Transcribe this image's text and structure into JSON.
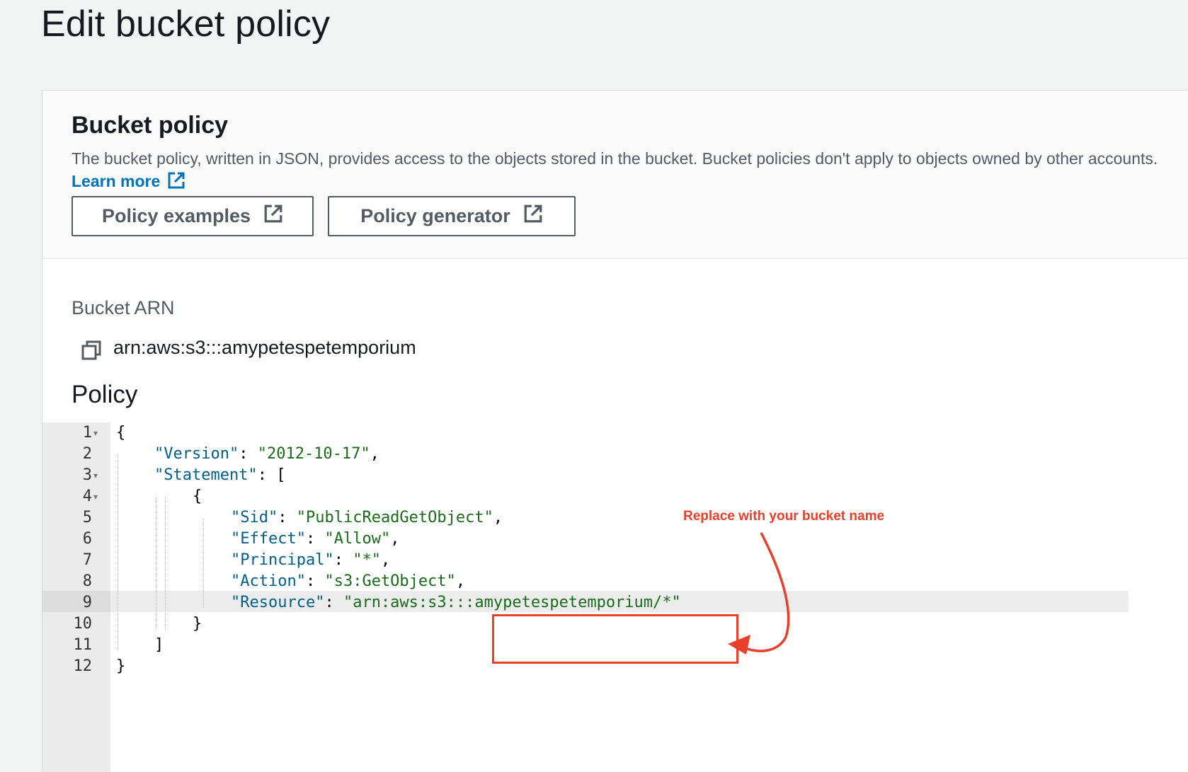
{
  "page": {
    "title": "Edit bucket policy"
  },
  "bucket_policy": {
    "heading": "Bucket policy",
    "description": "The bucket policy, written in JSON, provides access to the objects stored in the bucket. Bucket policies don't apply to objects owned by other accounts.",
    "learn_more": "Learn more",
    "buttons": {
      "examples": "Policy examples",
      "generator": "Policy generator"
    },
    "icons": {
      "external": "external-link-icon",
      "copy": "copy-icon"
    }
  },
  "arn": {
    "label": "Bucket ARN",
    "value": "arn:aws:s3:::amypetespetemporium"
  },
  "policy": {
    "label": "Policy",
    "line_numbers": [
      "1",
      "2",
      "3",
      "4",
      "5",
      "6",
      "7",
      "8",
      "9",
      "10",
      "11",
      "12"
    ],
    "lines": [
      {
        "tokens": [
          {
            "t": "p",
            "v": "{"
          }
        ]
      },
      {
        "tokens": [
          {
            "t": "k",
            "v": "\"Version\""
          },
          {
            "t": "p",
            "v": ": "
          },
          {
            "t": "s",
            "v": "\"2012-10-17\""
          },
          {
            "t": "p",
            "v": ","
          }
        ]
      },
      {
        "tokens": [
          {
            "t": "k",
            "v": "\"Statement\""
          },
          {
            "t": "p",
            "v": ": ["
          }
        ]
      },
      {
        "tokens": [
          {
            "t": "p",
            "v": "{"
          }
        ]
      },
      {
        "tokens": [
          {
            "t": "k",
            "v": "\"Sid\""
          },
          {
            "t": "p",
            "v": ": "
          },
          {
            "t": "s",
            "v": "\"PublicReadGetObject\""
          },
          {
            "t": "p",
            "v": ","
          }
        ]
      },
      {
        "tokens": [
          {
            "t": "k",
            "v": "\"Effect\""
          },
          {
            "t": "p",
            "v": ": "
          },
          {
            "t": "s",
            "v": "\"Allow\""
          },
          {
            "t": "p",
            "v": ","
          }
        ]
      },
      {
        "tokens": [
          {
            "t": "k",
            "v": "\"Principal\""
          },
          {
            "t": "p",
            "v": ": "
          },
          {
            "t": "s",
            "v": "\"*\""
          },
          {
            "t": "p",
            "v": ","
          }
        ]
      },
      {
        "tokens": [
          {
            "t": "k",
            "v": "\"Action\""
          },
          {
            "t": "p",
            "v": ": "
          },
          {
            "t": "s",
            "v": "\"s3:GetObject\""
          },
          {
            "t": "p",
            "v": ","
          }
        ]
      },
      {
        "tokens": [
          {
            "t": "k",
            "v": "\"Resource\""
          },
          {
            "t": "p",
            "v": ": "
          },
          {
            "t": "s",
            "v": "\"arn:aws:s3:::amypetespetemporium/*\""
          }
        ]
      },
      {
        "tokens": [
          {
            "t": "p",
            "v": "}"
          }
        ]
      },
      {
        "tokens": [
          {
            "t": "p",
            "v": "]"
          }
        ]
      },
      {
        "tokens": [
          {
            "t": "p",
            "v": "}"
          }
        ]
      }
    ],
    "active_line": "9"
  },
  "annotation": {
    "text": "Replace with your bucket name",
    "color": "#e8402a"
  },
  "colors": {
    "link": "#0073bb",
    "json_key": "#005f8a",
    "json_string": "#1a6b1a"
  }
}
